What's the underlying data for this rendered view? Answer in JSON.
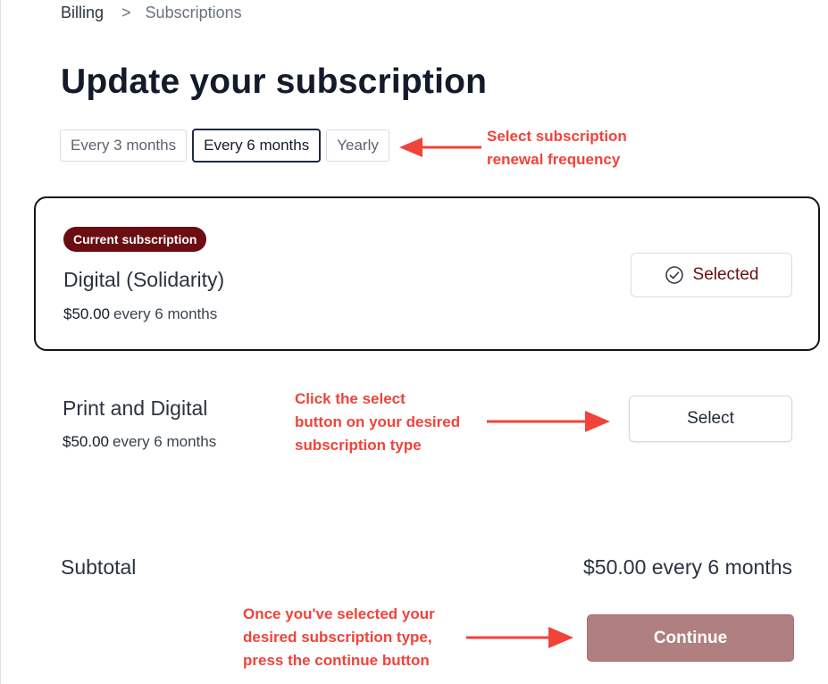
{
  "breadcrumb": {
    "parent": "Billing",
    "separator": ">",
    "current": "Subscriptions"
  },
  "page_title": "Update your subscription",
  "frequency_tabs": [
    {
      "label": "Every 3 months",
      "active": false
    },
    {
      "label": "Every 6 months",
      "active": true
    },
    {
      "label": "Yearly",
      "active": false
    }
  ],
  "annotations": {
    "frequency_line1": "Select subscription",
    "frequency_line2": "renewal frequency",
    "select_line1": "Click the select",
    "select_line2": "button on your desired",
    "select_line3": "subscription type",
    "continue_line1": "Once you've selected your",
    "continue_line2": "desired subscription type,",
    "continue_line3": "press the continue button"
  },
  "plans": [
    {
      "badge": "Current subscription",
      "name": "Digital (Solidarity)",
      "price": "$50.00",
      "period": "every 6 months",
      "button_label": "Selected",
      "button_icon": "check-circle-icon"
    },
    {
      "name": "Print and Digital",
      "price": "$50.00",
      "period": "every 6 months",
      "button_label": "Select"
    }
  ],
  "subtotal": {
    "label": "Subtotal",
    "value": "$50.00 every 6 months"
  },
  "continue_label": "Continue",
  "colors": {
    "brand": "#6b0d12",
    "continue_bg": "#b07f7f",
    "annotation": "#f0433a",
    "active_border": "#1f2b3d"
  }
}
